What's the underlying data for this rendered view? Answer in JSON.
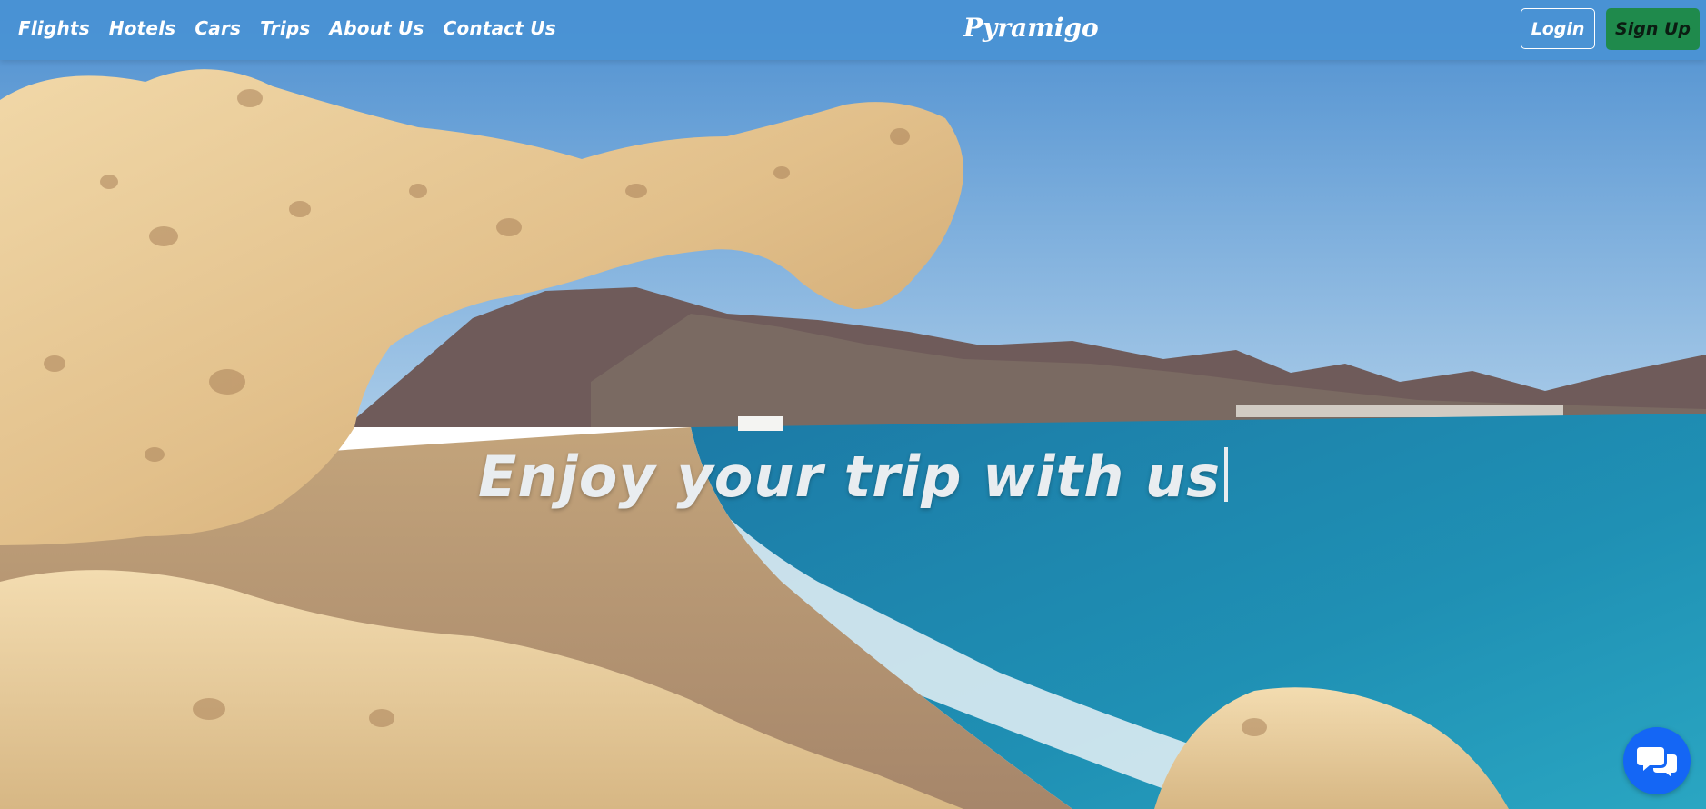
{
  "nav": {
    "links": [
      "Flights",
      "Hotels",
      "Cars",
      "Trips",
      "About Us",
      "Contact Us"
    ],
    "brand": "Pyramigo",
    "login_label": "Login",
    "signup_label": "Sign Up"
  },
  "hero": {
    "title": "Enjoy your trip with us"
  },
  "chat": {
    "icon": "chat-bubbles-icon"
  },
  "colors": {
    "navbar": "#4892d4",
    "signup": "#1f8a4c",
    "chat": "#1466f5",
    "sky": "#7fb4e3",
    "sea": "#1d7fa8",
    "sand": "#c9a678"
  }
}
